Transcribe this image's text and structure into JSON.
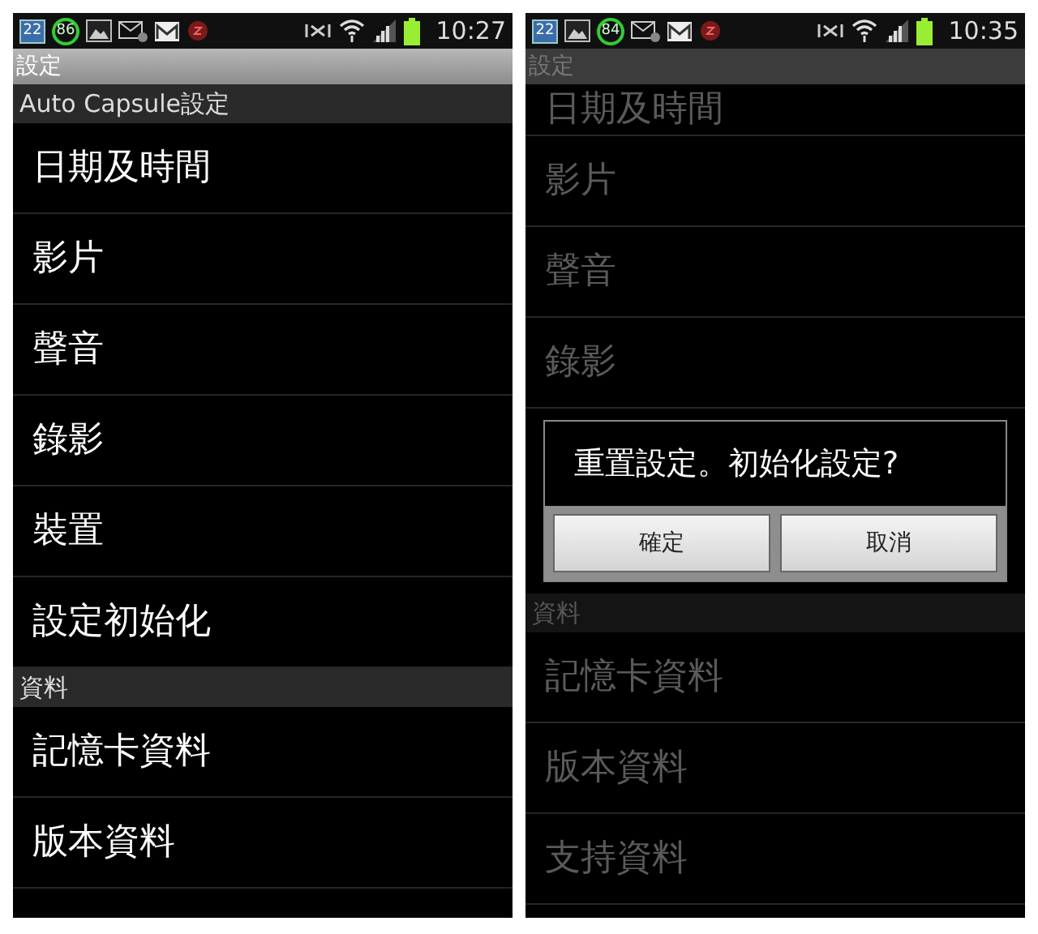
{
  "screens": [
    {
      "status_bar": {
        "icons": [
          {
            "kind": "calendar",
            "text": "22"
          },
          {
            "kind": "ring",
            "text": "86"
          },
          {
            "kind": "image"
          },
          {
            "kind": "mail_x"
          },
          {
            "kind": "gmail"
          },
          {
            "kind": "shield"
          }
        ],
        "right_icons": [
          {
            "kind": "mute"
          },
          {
            "kind": "wifi"
          },
          {
            "kind": "signal"
          },
          {
            "kind": "battery"
          }
        ],
        "time": "10:27"
      },
      "title": "設定",
      "dimmed": false,
      "list": [
        {
          "kind": "header",
          "label": "Auto  Capsule設定"
        },
        {
          "kind": "item",
          "label": "日期及時間"
        },
        {
          "kind": "item",
          "label": "影片"
        },
        {
          "kind": "item",
          "label": "聲音"
        },
        {
          "kind": "item",
          "label": "錄影"
        },
        {
          "kind": "item",
          "label": "裝置"
        },
        {
          "kind": "item",
          "label": "設定初始化"
        },
        {
          "kind": "header",
          "label": "資料"
        },
        {
          "kind": "item",
          "label": "記憶卡資料"
        },
        {
          "kind": "item",
          "label": "版本資料"
        }
      ]
    },
    {
      "status_bar": {
        "icons": [
          {
            "kind": "calendar",
            "text": "22"
          },
          {
            "kind": "image"
          },
          {
            "kind": "ring",
            "text": "84"
          },
          {
            "kind": "mail_x"
          },
          {
            "kind": "gmail"
          },
          {
            "kind": "shield"
          }
        ],
        "right_icons": [
          {
            "kind": "mute"
          },
          {
            "kind": "wifi"
          },
          {
            "kind": "signal"
          },
          {
            "kind": "battery"
          }
        ],
        "time": "10:35"
      },
      "title": "設定",
      "dimmed": true,
      "list": [
        {
          "kind": "cut_item",
          "label": "日期及時間"
        },
        {
          "kind": "item",
          "label": "影片"
        },
        {
          "kind": "item",
          "label": "聲音"
        },
        {
          "kind": "item",
          "label": "錄影"
        },
        {
          "kind": "dialog",
          "message": "重置設定。初始化設定?",
          "buttons": [
            "確定",
            "取消"
          ]
        },
        {
          "kind": "header",
          "label": "資料"
        },
        {
          "kind": "item",
          "label": "記憶卡資料"
        },
        {
          "kind": "item",
          "label": "版本資料"
        },
        {
          "kind": "item",
          "label": "支持資料"
        }
      ]
    }
  ]
}
